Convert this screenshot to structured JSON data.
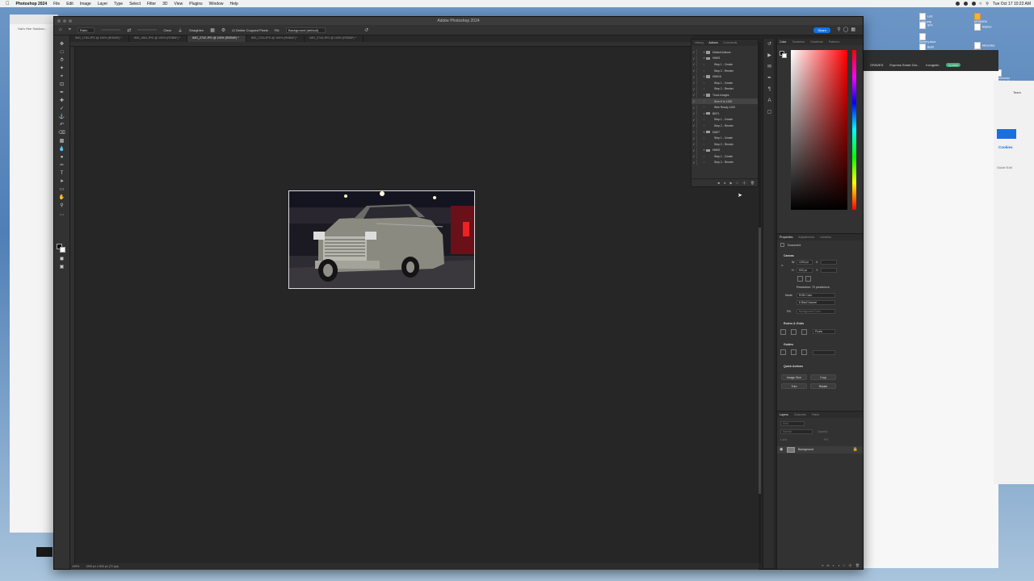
{
  "menubar": {
    "app_name": "Photoshop 2024",
    "items": [
      "File",
      "Edit",
      "Image",
      "Layer",
      "Type",
      "Select",
      "Filter",
      "3D",
      "View",
      "Plugins",
      "Window",
      "Help"
    ],
    "clock": "Tue Oct 17  10:22 AM"
  },
  "desktop_icons": [
    "LAX Logo.png",
    "SFK",
    "Nursery.docx",
    "Build Notebook.key",
    "MYWORK",
    "Retired",
    "Mercedes Mechanic...",
    "Screenshot 2023-06-18 at 10:41:37 AM"
  ],
  "bg_windows": {
    "left_text": "Hal's Hire Solution...",
    "chrome_items": [
      "GRAVES",
      "Express Smart Gui...",
      "www.azureai.https..."
    ],
    "incognito": "Incognito",
    "update": "Update",
    "cookies": "Cookies",
    "side_edit": "Guide Edit",
    "team": "Team"
  },
  "window": {
    "title": "Adobe Photoshop 2024"
  },
  "options_bar": {
    "ratio": "Ratio",
    "clear": "Clear",
    "straighten": "Straighten",
    "delete_cropped": "Delete Cropped Pixels",
    "fill_label": "Fill:",
    "fill_value": "Background (default)",
    "share": "Share"
  },
  "tabs": [
    {
      "label": "IMG_1784.JPG @ 100% (RGB/8*) *",
      "active": false
    },
    {
      "label": "IMG_1861.JPG @ 100% (RGB/8*) *",
      "active": false
    },
    {
      "label": "IMG_2742.JPG @ 100% (RGB/8*) *",
      "active": true
    },
    {
      "label": "IMG_2743.JPG @ 100% (RGB/8*) *",
      "active": false
    },
    {
      "label": "IMG_2744.JPG @ 100% (RGB/8*) *",
      "active": false
    }
  ],
  "actions_panel": {
    "tabs": [
      "History",
      "Actions",
      "Comments"
    ],
    "active_tab": "Actions",
    "rows": [
      {
        "label": "Default Actions",
        "kind": "set"
      },
      {
        "label": "HBKS",
        "kind": "set"
      },
      {
        "label": "Step 1 - Create",
        "kind": "step"
      },
      {
        "label": "Step 2 - Render",
        "kind": "step"
      },
      {
        "label": "HBK16",
        "kind": "set"
      },
      {
        "label": "Step 1 - Create",
        "kind": "step"
      },
      {
        "label": "Step 2 - Render",
        "kind": "step"
      },
      {
        "label": "Truck Images",
        "kind": "set"
      },
      {
        "label": "Size H to 1200",
        "kind": "step",
        "selected": true
      },
      {
        "label": "Web Ready 1200",
        "kind": "step"
      },
      {
        "label": "BEF1",
        "kind": "set"
      },
      {
        "label": "Step 1 - Create",
        "kind": "step"
      },
      {
        "label": "Step 2 - Render",
        "kind": "step"
      },
      {
        "label": "DM27",
        "kind": "set"
      },
      {
        "label": "Step 1 - Create",
        "kind": "step"
      },
      {
        "label": "Step 2 - Render",
        "kind": "step"
      },
      {
        "label": "HBKS",
        "kind": "set"
      },
      {
        "label": "Step 1 - Create",
        "kind": "step"
      },
      {
        "label": "Step 2 - Render",
        "kind": "step"
      }
    ]
  },
  "color_panel": {
    "tabs": [
      "Color",
      "Swatches",
      "Gradients",
      "Patterns"
    ],
    "active_tab": "Color",
    "hue_color": "#ff0000"
  },
  "properties": {
    "tabs": [
      "Properties",
      "Adjustments",
      "Libraries"
    ],
    "active_tab": "Properties",
    "doc_label": "Document",
    "canvas_label": "Canvas",
    "width": "1200 px",
    "height": "633 px",
    "x_label": "X",
    "y_label": "Y",
    "resolution": "Resolution: 72 pixels/inch",
    "mode_label": "Mode",
    "mode_value": "RGB Color",
    "depth_value": "8 Bits/Channel",
    "fill_label": "Fill",
    "fill_value": "Background Color",
    "rulers_label": "Rulers & Grids",
    "units_value": "Pixels",
    "guides_label": "Guides",
    "quick_actions_label": "Quick Actions",
    "buttons": [
      "Image Size",
      "Crop",
      "Trim",
      "Rotate"
    ]
  },
  "layers": {
    "tabs": [
      "Layers",
      "Channels",
      "Paths"
    ],
    "active_tab": "Layers",
    "kind_label": "Kind",
    "blend_mode": "Normal",
    "opacity_label": "Opacity:",
    "lock_label": "Lock:",
    "fill_label": "Fill:",
    "layer_name": "Background"
  },
  "statusbar": {
    "zoom": "100%",
    "doc_info": "1200 px x 633 px (72 ppi)"
  }
}
